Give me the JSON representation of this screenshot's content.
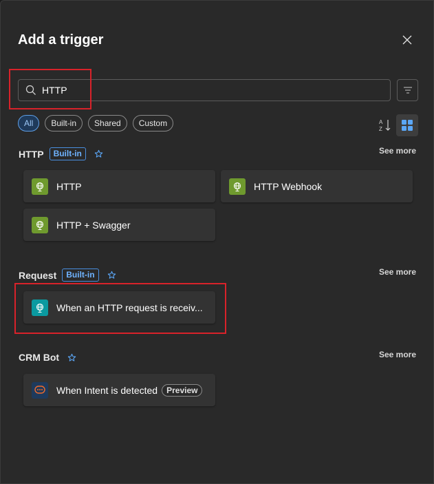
{
  "panel": {
    "title": "Add a trigger"
  },
  "search": {
    "value": "HTTP",
    "placeholder": "Search"
  },
  "filters": [
    {
      "label": "All",
      "active": true
    },
    {
      "label": "Built-in",
      "active": false
    },
    {
      "label": "Shared",
      "active": false
    },
    {
      "label": "Custom",
      "active": false
    }
  ],
  "sections": {
    "http": {
      "name": "HTTP",
      "badge": "Built-in",
      "see_more": "See more",
      "items": [
        {
          "label": "HTTP",
          "icon": "globe-icon",
          "color": "#6f9a2e"
        },
        {
          "label": "HTTP Webhook",
          "icon": "globe-icon",
          "color": "#6f9a2e"
        },
        {
          "label": "HTTP + Swagger",
          "icon": "globe-icon",
          "color": "#6f9a2e"
        }
      ]
    },
    "request": {
      "name": "Request",
      "badge": "Built-in",
      "see_more": "See more",
      "items": [
        {
          "label": "When an HTTP request is receiv...",
          "icon": "globe-icon",
          "color": "#0b9aa0"
        }
      ]
    },
    "crm_bot": {
      "name": "CRM Bot",
      "see_more": "See more",
      "items": [
        {
          "label": "When Intent is detected",
          "badge": "Preview",
          "icon": "chat-bubble-icon",
          "color": "#1e3a5c"
        }
      ]
    }
  },
  "colors": {
    "highlight": "#d9222a",
    "accent": "#4a90e2",
    "panel_bg": "#292929",
    "card_bg": "#333333"
  }
}
